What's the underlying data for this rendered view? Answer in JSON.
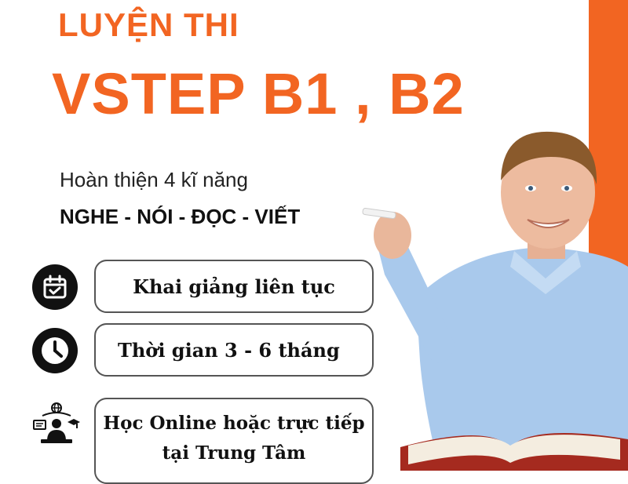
{
  "colors": {
    "accent": "#f26522",
    "text": "#111111",
    "shirt": "#9fc3e8"
  },
  "header": {
    "title_line1": "LUYỆN THI",
    "title_line2": "VSTEP B1 , B2"
  },
  "intro": {
    "subtitle": "Hoàn thiện 4 kĩ năng",
    "skills": "NGHE - NÓI - ĐỌC - VIẾT"
  },
  "features": [
    {
      "icon": "calendar-check-icon",
      "text": "Khai giảng liên tục"
    },
    {
      "icon": "clock-icon",
      "text": "Thời gian 3 - 6 tháng"
    },
    {
      "icon": "online-learning-icon",
      "line1": "Học Online hoặc trực tiếp",
      "line2": "tại Trung Tâm"
    }
  ]
}
